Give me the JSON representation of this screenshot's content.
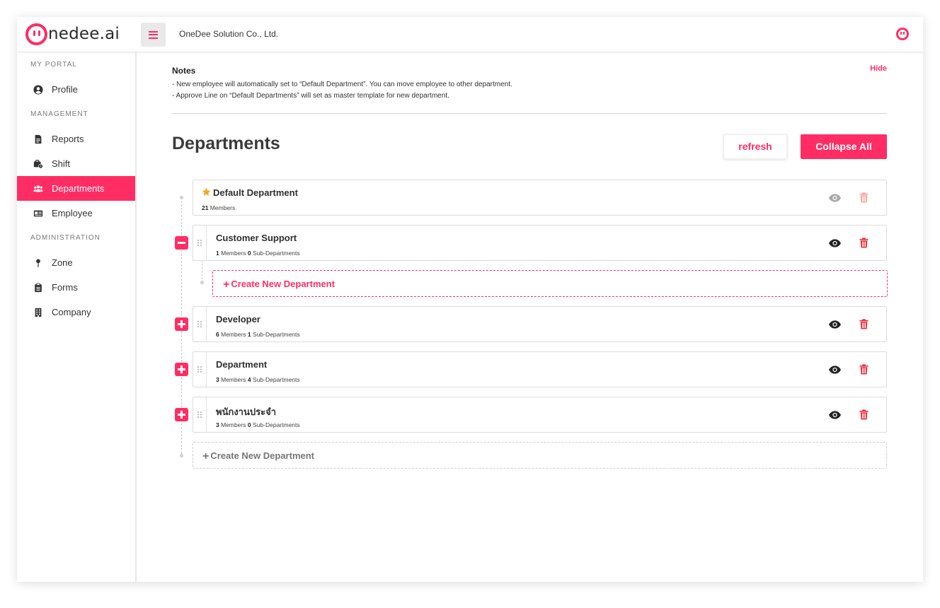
{
  "app": {
    "logo_text": "nedee.ai",
    "company": "OneDee Solution Co., Ltd.",
    "brand_color": "#ff2d64"
  },
  "sidebar": {
    "sections": [
      {
        "label": "MY PORTAL",
        "items": [
          {
            "label": "Profile",
            "icon": "user-circle-icon"
          }
        ]
      },
      {
        "label": "MANAGEMENT",
        "items": [
          {
            "label": "Reports",
            "icon": "file-icon"
          },
          {
            "label": "Shift",
            "icon": "briefcase-clock-icon"
          },
          {
            "label": "Departments",
            "icon": "users-icon",
            "active": true
          },
          {
            "label": "Employee",
            "icon": "id-card-icon"
          }
        ]
      },
      {
        "label": "ADMINISTRATION",
        "items": [
          {
            "label": "Zone",
            "icon": "map-pin-icon"
          },
          {
            "label": "Forms",
            "icon": "clipboard-icon"
          },
          {
            "label": "Company",
            "icon": "building-icon"
          }
        ]
      }
    ]
  },
  "notes": {
    "title": "Notes",
    "hide_label": "Hide",
    "lines": [
      "- New employee will automatically set to “Default Department”. You can move employee to other department.",
      "- Approve Line on “Default Departments” will set as master template for new department."
    ]
  },
  "page": {
    "title": "Departments",
    "refresh_label": "refresh",
    "collapse_label": "Collapse All"
  },
  "departments": [
    {
      "name": "Default Department",
      "members": "21",
      "members_label": "Members",
      "is_default": true
    },
    {
      "name": "Customer Support",
      "members": "1",
      "members_label": "Members",
      "subs": "0",
      "subs_label": "Sub-Departments",
      "expanded": true
    },
    {
      "name": "Developer",
      "members": "6",
      "members_label": "Members",
      "subs": "1",
      "subs_label": "Sub-Departments"
    },
    {
      "name": "Department",
      "members": "3",
      "members_label": "Members",
      "subs": "4",
      "subs_label": "Sub-Departments"
    },
    {
      "name": "พนักงานประจำ",
      "members": "3",
      "members_label": "Members",
      "subs": "0",
      "subs_label": "Sub-Departments"
    }
  ],
  "create_sub_label": "Create New Department",
  "create_root_label": "Create New Department"
}
